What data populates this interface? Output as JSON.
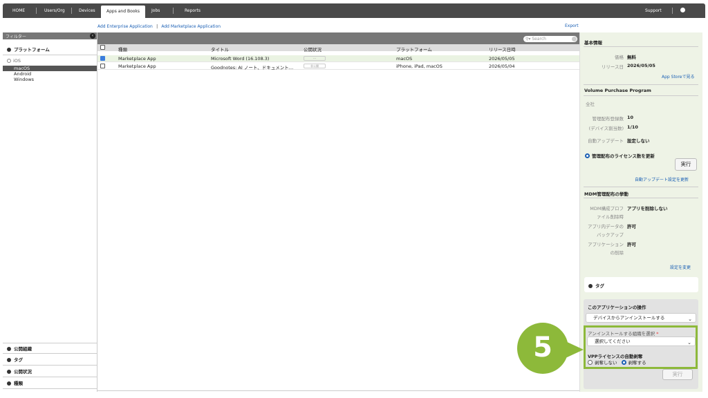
{
  "nav": {
    "items": [
      "HOME",
      "Users/Org",
      "Devices",
      "Apps and Books",
      "Jobs",
      "Reports"
    ],
    "support": "Support",
    "settings": "Settings"
  },
  "links": {
    "add_enterprise": "Add Enterprise Application",
    "pipe": "|",
    "add_marketplace": "Add Marketplace Application",
    "export": "Export"
  },
  "filter": {
    "header": "フィルター",
    "platform": "プラットフォーム",
    "ios": "iOS",
    "platforms": [
      "macOS",
      "Android",
      "Windows"
    ],
    "bottom_sections": [
      "公開組織",
      "タグ",
      "公開状況",
      "種類"
    ]
  },
  "search": {
    "placeholder": "Search"
  },
  "table": {
    "columns": [
      "種類",
      "タイトル",
      "公開状況",
      "プラットフォーム",
      "リリース日時"
    ],
    "rows": [
      {
        "type": "Marketplace App",
        "title": "Microsoft Word (16.108.3)",
        "status": "---",
        "platform": "macOS",
        "date": "2026/05/05"
      },
      {
        "type": "Marketplace App",
        "title": "Goodnotes: AI ノート、ドキュメント…",
        "status": "非公開",
        "platform": "iPhone, iPad, macOS",
        "date": "2026/05/04"
      }
    ]
  },
  "detail": {
    "basic_title": "基本情報",
    "price_label": "価格",
    "price_value": "無料",
    "release_label": "リリース日",
    "release_value": "2026/05/05",
    "appstore_link": "App Storeで見る",
    "vpp_title": "Volume Purchase Program",
    "all_company": "全社",
    "managed_count_label": "管理配布登録数",
    "managed_count_value": "10",
    "device_assign_label": "(デバイス割当数)",
    "device_assign_value": "1/10",
    "auto_update_label": "自動アップデート",
    "auto_update_value": "設定しない",
    "license_update_radio": "管理配布のライセンス数を更新",
    "run_button": "実行",
    "auto_update_link": "自動アップデート設定を更新",
    "mdm_title": "MDM管理配布の挙動",
    "mdm_profile_label_1": "MDM構成プロフ",
    "mdm_profile_label_2": "ァイル削除時",
    "mdm_profile_value": "アプリを削除しない",
    "backup_label_1": "アプリ内データの",
    "backup_label_2": "バックアップ",
    "backup_value": "許可",
    "delete_label_1": "アプリケーション",
    "delete_label_2": "の削除",
    "delete_value": "許可",
    "settings_change_link": "設定を変更",
    "tag_label": "タグ",
    "ops_title": "このアプリケーションの操作",
    "ops_select": "デバイスからアンインストールする",
    "org_select_label": "アンインストールする組織を選択",
    "required_mark": "*",
    "org_select_value": "選択してください",
    "vpp_revoke_title": "VPPライセンスの自動剥奪",
    "radio_no": "剥奪しない",
    "radio_yes": "剥奪する",
    "exec_button": "実行"
  },
  "callout": {
    "number": "5"
  },
  "colors": {
    "accent_green": "#8db93a",
    "nav_bg": "#4a4a4a",
    "link": "#1a5fb4"
  }
}
